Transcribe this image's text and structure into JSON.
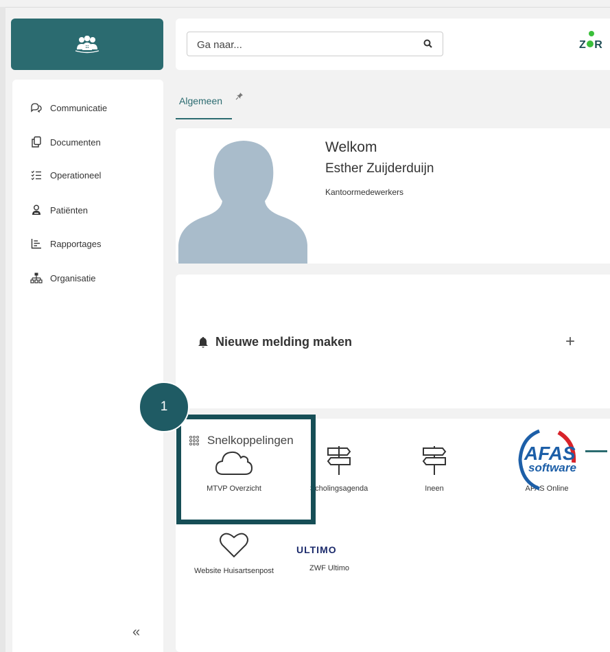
{
  "header": {
    "search_placeholder": "Ga naar...",
    "brand_text_left": "Z",
    "brand_text_right": "R"
  },
  "sidebar": {
    "items": [
      {
        "label": "Communicatie",
        "icon": "chat-icon"
      },
      {
        "label": "Documenten",
        "icon": "documents-icon"
      },
      {
        "label": "Operationeel",
        "icon": "checklist-icon"
      },
      {
        "label": "Patiënten",
        "icon": "patient-icon"
      },
      {
        "label": "Rapportages",
        "icon": "report-icon"
      },
      {
        "label": "Organisatie",
        "icon": "org-chart-icon"
      }
    ],
    "collapse_label": "«"
  },
  "tabs": [
    {
      "label": "Algemeen",
      "active": true
    }
  ],
  "welcome": {
    "title": "Welkom",
    "name": "Esther Zuijderduijn",
    "role": "Kantoormedewerkers"
  },
  "notification": {
    "label": "Nieuwe melding maken",
    "add_label": "+"
  },
  "shortcuts": {
    "title": "Snelkoppelingen",
    "items": [
      {
        "label": "MTVP Overzicht",
        "icon": "cloud-icon"
      },
      {
        "label": "Scholingsagenda",
        "icon": "signpost-icon"
      },
      {
        "label": "Ineen",
        "icon": "signpost-icon"
      },
      {
        "label": "AFAS Online",
        "icon": "afas-logo"
      },
      {
        "label": "Website Huisartsenpost",
        "icon": "heart-icon"
      },
      {
        "label": "ZWF Ultimo",
        "icon": "ultimo-logo"
      }
    ]
  },
  "annotation": {
    "step_number": "1"
  },
  "colors": {
    "accent": "#2b6b70",
    "highlight": "#164e56",
    "badge": "#1f5b64",
    "afas_blue": "#1d5fa8",
    "afas_red": "#d8232a"
  }
}
